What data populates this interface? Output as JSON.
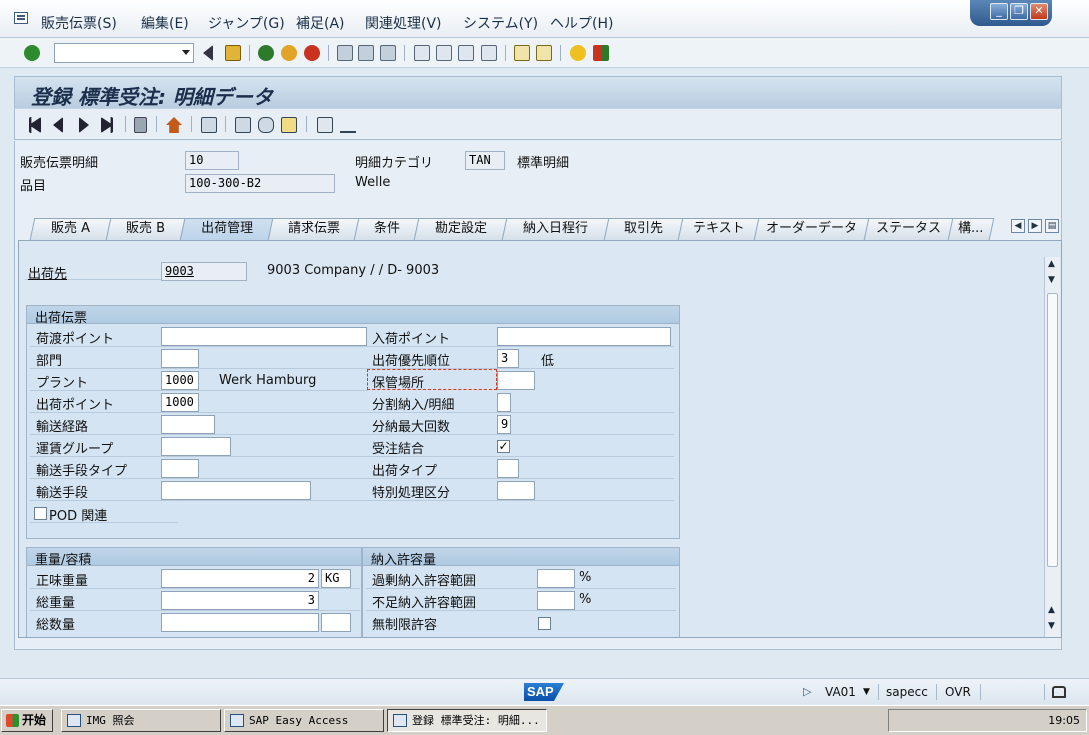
{
  "menu": {
    "items": [
      "販売伝票(S)",
      "編集(E)",
      "ジャンプ(G)",
      "補足(A)",
      "関連処理(V)",
      "システム(Y)",
      "ヘルプ(H)"
    ]
  },
  "window_controls": {
    "minimize": "_",
    "restore": "❐",
    "close": "✕"
  },
  "toolbar": {
    "command_field_value": ""
  },
  "title": "登録 標準受注: 明細データ",
  "header": {
    "item_label": "販売伝票明細",
    "item_value": "10",
    "category_label": "明細カテゴリ",
    "category_value": "TAN",
    "category_desc": "標準明細",
    "material_label": "品目",
    "material_value": "100-300-B2",
    "material_desc": "Welle"
  },
  "tabs": [
    "販売 A",
    "販売 B",
    "出荷管理",
    "請求伝票",
    "条件",
    "勘定設定",
    "納入日程行",
    "取引先",
    "テキスト",
    "オーダーデータ",
    "ステータス",
    "構..."
  ],
  "active_tab": "出荷管理",
  "shipto": {
    "label": "出荷先",
    "value": "9003",
    "desc": "9003 Company / / D- 9003"
  },
  "shipping": {
    "title": "出荷伝票",
    "left": [
      {
        "label": "荷渡ポイント",
        "value": ""
      },
      {
        "label": "部門",
        "value": ""
      },
      {
        "label": "プラント",
        "value": "1000",
        "desc": "Werk Hamburg"
      },
      {
        "label": "出荷ポイント",
        "value": "1000"
      },
      {
        "label": "輸送経路",
        "value": ""
      },
      {
        "label": "運賃グループ",
        "value": ""
      },
      {
        "label": "輸送手段タイプ",
        "value": ""
      },
      {
        "label": "輸送手段",
        "value": ""
      }
    ],
    "pod_label": "POD 関連",
    "right": [
      {
        "label": "入荷ポイント",
        "value": ""
      },
      {
        "label": "出荷優先順位",
        "value": "3",
        "desc": "低"
      },
      {
        "label": "保管場所",
        "value": ""
      },
      {
        "label": "分割納入/明細",
        "value": ""
      },
      {
        "label": "分納最大回数",
        "value": "9"
      },
      {
        "label": "受注結合",
        "value": "✓"
      },
      {
        "label": "出荷タイプ",
        "value": ""
      },
      {
        "label": "特別処理区分",
        "value": ""
      }
    ]
  },
  "weight": {
    "title": "重量/容積",
    "net_label": "正味重量",
    "net_value": "2",
    "net_unit": "KG",
    "gross_label": "総重量",
    "gross_value": "3",
    "volume_label": "総数量",
    "volume_value": ""
  },
  "tolerance": {
    "title": "納入許容量",
    "over_label": "過剰納入許容範囲",
    "over_unit": "%",
    "under_label": "不足納入許容範囲",
    "under_unit": "%",
    "unlimited_label": "無制限許容"
  },
  "status": {
    "logo": "SAP",
    "transaction": "VA01",
    "system": "sapecc",
    "mode": "OVR"
  },
  "taskbar": {
    "start": "开始",
    "tasks": [
      "IMG 照会",
      "SAP Easy Access",
      "登録 標準受注: 明細..."
    ],
    "clock": "19:05"
  },
  "colors": {
    "accent": "#1b2f4c",
    "tab_active": "#bcd3ea",
    "panel": "#dbe8f3"
  }
}
